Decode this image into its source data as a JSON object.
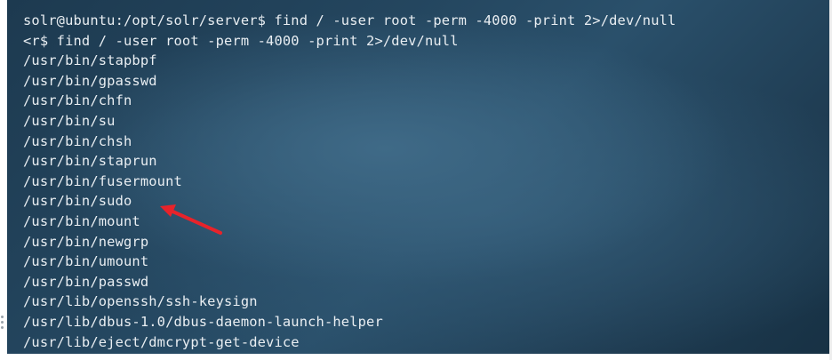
{
  "terminal": {
    "lines": [
      "solr@ubuntu:/opt/solr/server$ find / -user root -perm -4000 -print 2>/dev/null",
      "<r$ find / -user root -perm -4000 -print 2>/dev/null",
      "/usr/bin/stapbpf",
      "/usr/bin/gpasswd",
      "/usr/bin/chfn",
      "/usr/bin/su",
      "/usr/bin/chsh",
      "/usr/bin/staprun",
      "/usr/bin/fusermount",
      "/usr/bin/sudo",
      "/usr/bin/mount",
      "/usr/bin/newgrp",
      "/usr/bin/umount",
      "/usr/bin/passwd",
      "/usr/lib/openssh/ssh-keysign",
      "/usr/lib/dbus-1.0/dbus-daemon-launch-helper",
      "/usr/lib/eject/dmcrypt-get-device"
    ],
    "text_color": "#e9eef2",
    "background_color": "#24465f"
  },
  "annotation": {
    "icon": "red-arrow-icon",
    "color": "#e8232a",
    "points_to_line": "/usr/bin/sudo"
  }
}
